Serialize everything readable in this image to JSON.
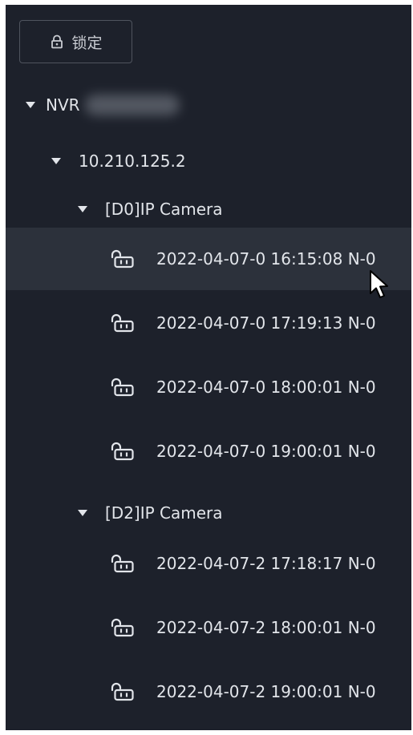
{
  "toolbar": {
    "lock_label": "锁定"
  },
  "tree": {
    "device": {
      "label": "NVR"
    },
    "address": {
      "label": "10.210.125.2"
    },
    "cameras": [
      {
        "label": "[D0]IP Camera",
        "records": [
          "2022-04-07-0 16:15:08 N-0",
          "2022-04-07-0 17:19:13 N-0",
          "2022-04-07-0 18:00:01 N-0",
          "2022-04-07-0 19:00:01 N-0"
        ]
      },
      {
        "label": "[D2]IP Camera",
        "records": [
          "2022-04-07-2 17:18:17 N-0",
          "2022-04-07-2 18:00:01 N-0",
          "2022-04-07-2 19:00:01 N-0"
        ]
      }
    ]
  },
  "icons": {
    "lock": "lock-icon",
    "unlock": "unlock-icon",
    "expand": "caret-down-icon",
    "cursor": "mouse-pointer-icon"
  },
  "colors": {
    "panel_bg": "#1d212b",
    "row_highlight": "#2c313b",
    "text": "#e2e5ea",
    "button_border": "#4f545e"
  }
}
